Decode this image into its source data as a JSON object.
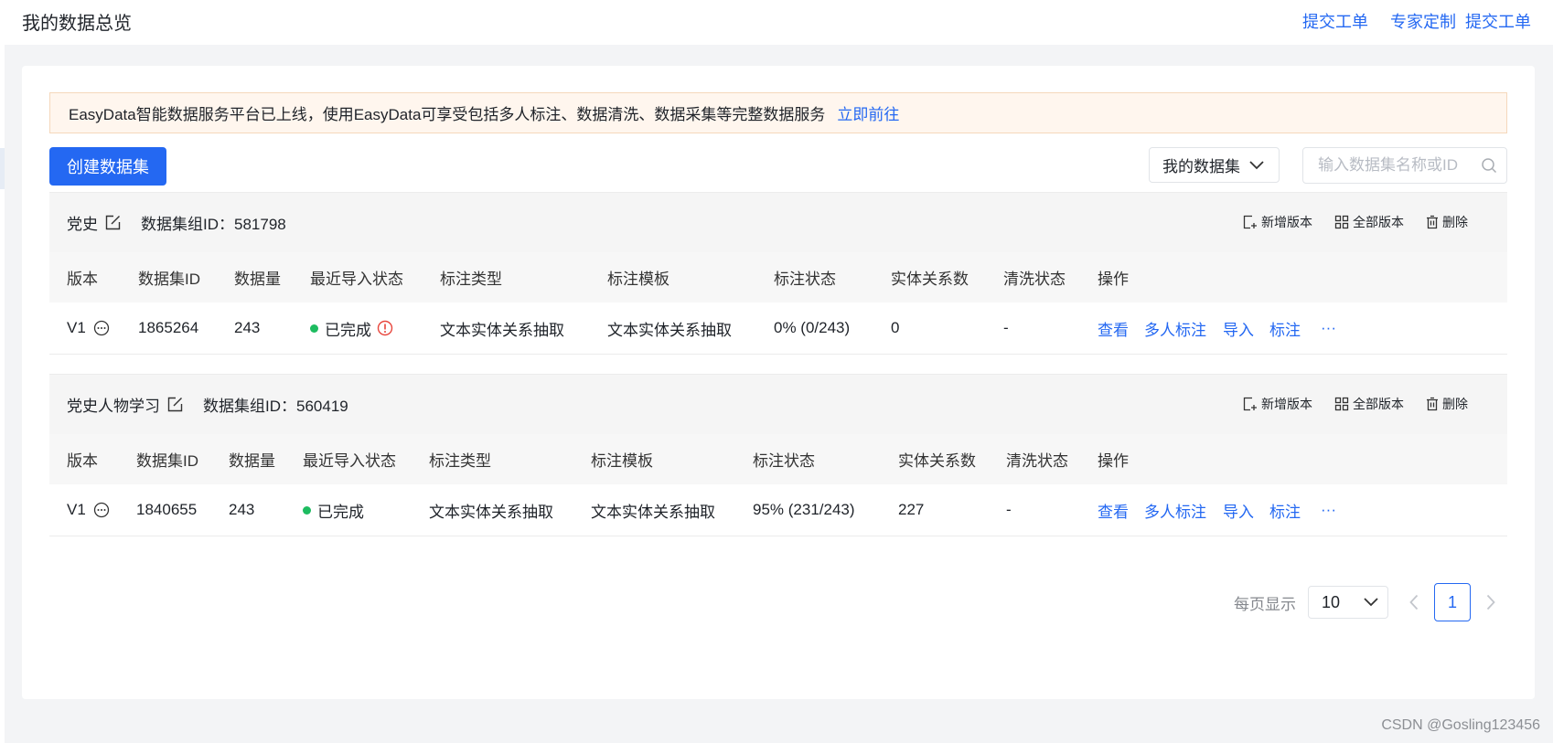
{
  "header": {
    "title": "我的数据总览",
    "links": [
      "提交工单",
      "专家定制",
      "提交工单"
    ]
  },
  "notice": {
    "text": "EasyData智能数据服务平台已上线，使用EasyData可享受包括多人标注、数据清洗、数据采集等完整数据服务",
    "link": "立即前往"
  },
  "toolbar": {
    "create_label": "创建数据集",
    "filter_value": "我的数据集",
    "search_placeholder": "输入数据集名称或ID"
  },
  "group_actions": {
    "add_version": "新增版本",
    "all_versions": "全部版本",
    "delete": "删除"
  },
  "columns": [
    "版本",
    "数据集ID",
    "数据量",
    "最近导入状态",
    "标注类型",
    "标注模板",
    "标注状态",
    "实体关系数",
    "清洗状态",
    "操作"
  ],
  "operations": [
    "查看",
    "多人标注",
    "导入",
    "标注",
    "···"
  ],
  "groups": [
    {
      "name": "党史",
      "group_id_label": "数据集组ID：581798",
      "rows": [
        {
          "version": "V1",
          "dataset_id": "1865264",
          "count": "243",
          "import_status": "已完成",
          "has_warning": true,
          "label_type": "文本实体关系抽取",
          "label_template": "文本实体关系抽取",
          "label_status": "0% (0/243)",
          "relation_count": "0",
          "clean_status": "-"
        }
      ]
    },
    {
      "name": "党史人物学习",
      "group_id_label": "数据集组ID：560419",
      "rows": [
        {
          "version": "V1",
          "dataset_id": "1840655",
          "count": "243",
          "import_status": "已完成",
          "has_warning": false,
          "label_type": "文本实体关系抽取",
          "label_template": "文本实体关系抽取",
          "label_status": "95% (231/243)",
          "relation_count": "227",
          "clean_status": "-"
        }
      ]
    }
  ],
  "pagination": {
    "page_size_label": "每页显示",
    "page_size": "10",
    "current_page": "1"
  },
  "watermark": "CSDN @Gosling123456",
  "colors": {
    "accent": "#2468f2",
    "success": "#1dbc60",
    "warning": "#e8453c",
    "notice_bg": "#fff6ee"
  },
  "icons": {
    "edit": "edit-icon",
    "add_version": "add-version-icon",
    "all_versions": "grid-icon",
    "delete": "trash-icon",
    "more": "more-circle-icon",
    "warning": "warning-circle-icon",
    "search": "search-icon",
    "dropdown": "chevron-down-icon"
  }
}
